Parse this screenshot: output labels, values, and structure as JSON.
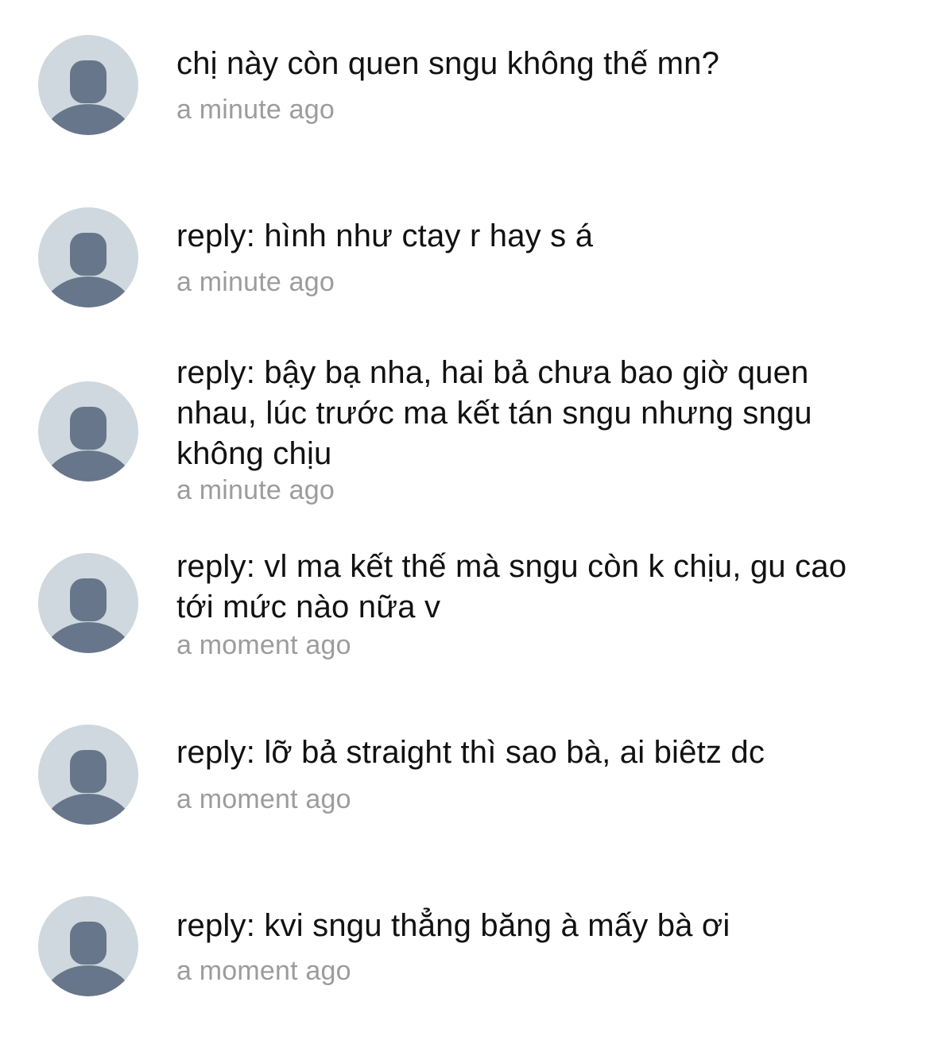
{
  "colors": {
    "background": "#ffffff",
    "avatar_bg": "#cfd8de",
    "avatar_figure": "#67768a",
    "text": "#111111",
    "timestamp": "#9c9c9c"
  },
  "comments": [
    {
      "icon": "user-avatar-icon",
      "text": "chị này còn quen sngu không thế mn?",
      "time": "a minute ago"
    },
    {
      "icon": "user-avatar-icon",
      "text": "reply: hình như ctay r hay s á",
      "time": "a minute ago"
    },
    {
      "icon": "user-avatar-icon",
      "text": "reply: bậy bạ nha, hai bả chưa bao giờ quen nhau, lúc trước ma kết tán sngu nhưng sngu không chịu",
      "time": "a minute ago"
    },
    {
      "icon": "user-avatar-icon",
      "text": "reply: vl ma kết thế mà sngu còn k chịu, gu cao tới mức nào nữa v",
      "time": "a moment ago"
    },
    {
      "icon": "user-avatar-icon",
      "text": "reply: lỡ bả straight thì sao bà, ai biêtz dc",
      "time": "a moment ago"
    },
    {
      "icon": "user-avatar-icon",
      "text": "reply: kvi sngu thẳng băng à mấy bà ơi",
      "time": "a moment ago"
    }
  ]
}
